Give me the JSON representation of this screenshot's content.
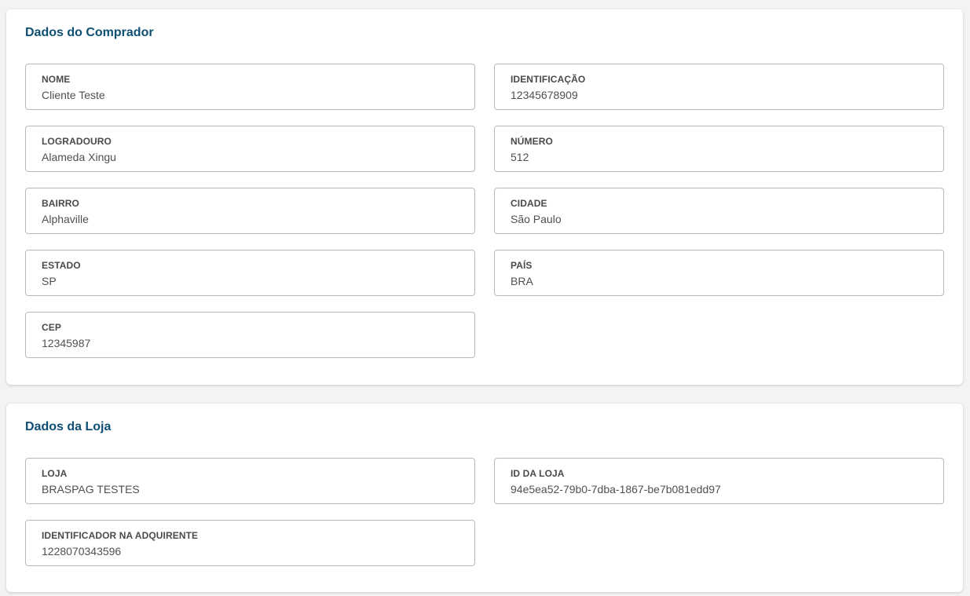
{
  "buyer": {
    "title": "Dados do Comprador",
    "fields": [
      {
        "label": "NOME",
        "value": "Cliente Teste"
      },
      {
        "label": "IDENTIFICAÇÃO",
        "value": "12345678909"
      },
      {
        "label": "LOGRADOURO",
        "value": "Alameda Xingu"
      },
      {
        "label": "NÚMERO",
        "value": "512"
      },
      {
        "label": "BAIRRO",
        "value": "Alphaville"
      },
      {
        "label": "CIDADE",
        "value": "São Paulo"
      },
      {
        "label": "ESTADO",
        "value": "SP"
      },
      {
        "label": "PAÍS",
        "value": "BRA"
      },
      {
        "label": "CEP",
        "value": "12345987"
      }
    ]
  },
  "store": {
    "title": "Dados da Loja",
    "fields": [
      {
        "label": "LOJA",
        "value": "BRASPAG TESTES"
      },
      {
        "label": "ID DA LOJA",
        "value": "94e5ea52-79b0-7dba-1867-be7b081edd97"
      },
      {
        "label": "IDENTIFICADOR NA ADQUIRENTE",
        "value": "1228070343596"
      }
    ]
  },
  "colors": {
    "title": "#0e4f73",
    "border": "#b9b9b9",
    "background": "#f3f3f3",
    "card": "#ffffff"
  }
}
